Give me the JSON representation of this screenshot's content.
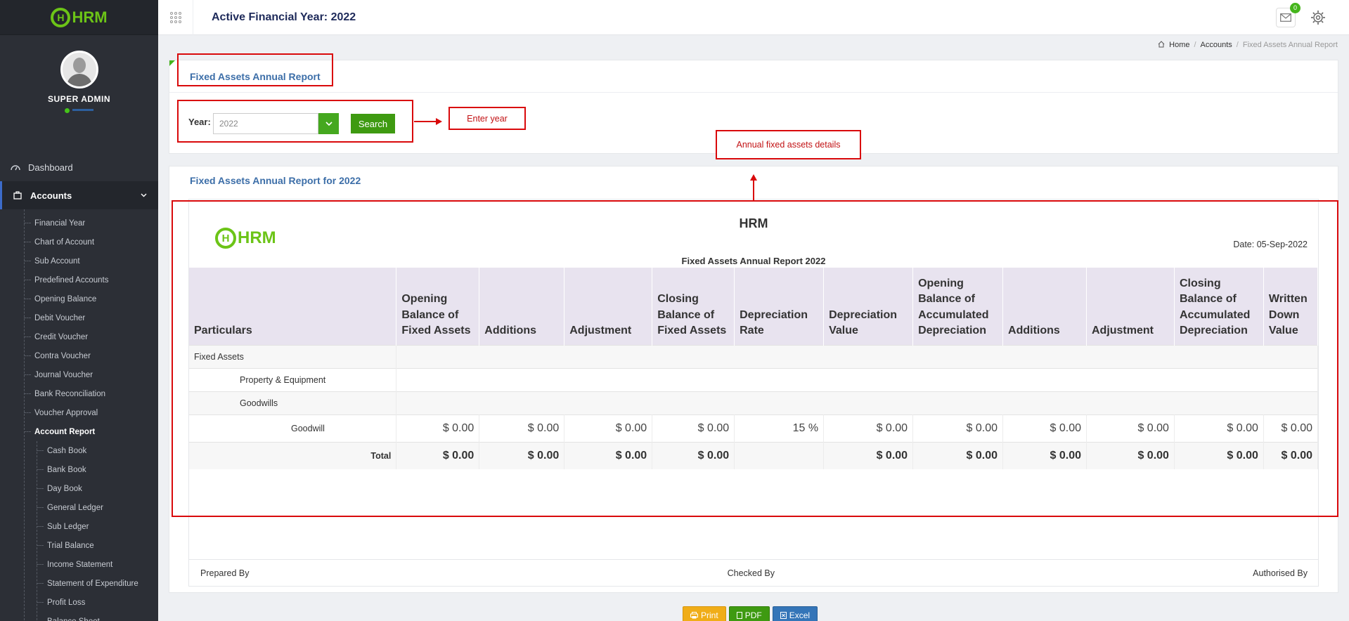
{
  "app": {
    "logo_text": "HRM",
    "logo_mark": "H"
  },
  "sidebar": {
    "user_name": "SUPER ADMIN",
    "dashboard_label": "Dashboard",
    "accounts_label": "Accounts",
    "items": [
      "Financial Year",
      "Chart of Account",
      "Sub Account",
      "Predefined Accounts",
      "Opening Balance",
      "Debit Voucher",
      "Credit Voucher",
      "Contra Voucher",
      "Journal Voucher",
      "Bank Reconciliation",
      "Voucher Approval",
      "Account Report"
    ],
    "report_items": [
      "Cash Book",
      "Bank Book",
      "Day Book",
      "General Ledger",
      "Sub Ledger",
      "Trial Balance",
      "Income Statement",
      "Statement of Expenditure",
      "Profit Loss",
      "Balance Sheet"
    ]
  },
  "header": {
    "active_year": "Active Financial Year: 2022",
    "mail_count": "0"
  },
  "breadcrumb": {
    "home": "Home",
    "accounts": "Accounts",
    "current": "Fixed Assets Annual Report"
  },
  "filter": {
    "panel_title": "Fixed Assets Annual Report",
    "year_label": "Year:",
    "year_value": "2022",
    "search_label": "Search"
  },
  "annotations": {
    "enter_year": "Enter year",
    "details": "Annual fixed assets details"
  },
  "report": {
    "panel_title": "Fixed Assets Annual Report for 2022",
    "company": "HRM",
    "date": "Date: 05-Sep-2022",
    "subtitle": "Fixed Assets Annual Report 2022",
    "columns": [
      "Particulars",
      "Opening Balance of Fixed Assets",
      "Additions",
      "Adjustment",
      "Closing Balance of Fixed Assets",
      "Depreciation Rate",
      "Depreciation Value",
      "Opening Balance of Accumulated Depreciation",
      "Additions",
      "Adjustment",
      "Closing Balance of Accumulated Depreciation",
      "Written Down Value"
    ],
    "group": "Fixed Assets",
    "subgroup1": "Property & Equipment",
    "subgroup2": "Goodwills",
    "row": {
      "name": "Goodwill",
      "values": [
        "$ 0.00",
        "$ 0.00",
        "$ 0.00",
        "$ 0.00",
        "15 %",
        "$ 0.00",
        "$ 0.00",
        "$ 0.00",
        "$ 0.00",
        "$ 0.00",
        "$ 0.00"
      ]
    },
    "total": {
      "label": "Total",
      "values": [
        "$ 0.00",
        "$ 0.00",
        "$ 0.00",
        "$ 0.00",
        "",
        "$ 0.00",
        "$ 0.00",
        "$ 0.00",
        "$ 0.00",
        "$ 0.00",
        "$ 0.00"
      ]
    },
    "prepared_by": "Prepared By",
    "checked_by": "Checked By",
    "authorised_by": "Authorised By"
  },
  "buttons": {
    "print": "Print",
    "pdf": "PDF",
    "excel": "Excel"
  },
  "colors": {
    "accent": "#3c6ea8",
    "brand_green": "#6cc417",
    "annotation_red": "#d9090b"
  }
}
